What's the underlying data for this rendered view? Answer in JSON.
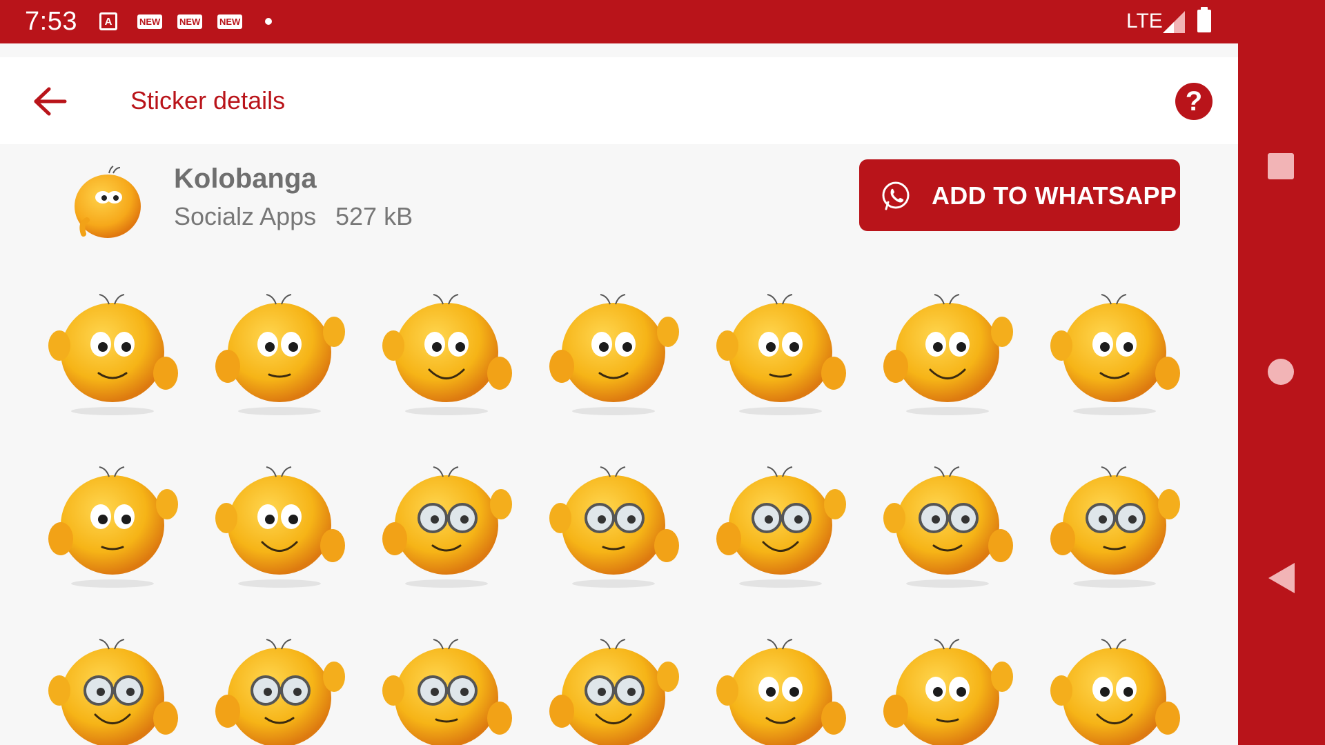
{
  "status_bar": {
    "time": "7:53",
    "notifications": [
      "app-icon",
      "new-badge",
      "new-badge",
      "new-badge",
      "dot"
    ],
    "notification_letter": "A",
    "new_label": "NEW",
    "network": "LTE"
  },
  "toolbar": {
    "title": "Sticker details",
    "help_label": "?"
  },
  "pack": {
    "name": "Kolobanga",
    "publisher": "Socialz Apps",
    "size": "527 kB",
    "add_button_label": "ADD TO WHATSAPP"
  },
  "stickers": [
    {
      "id": 1,
      "icon": "kolobanga-thumbs-up"
    },
    {
      "id": 2,
      "icon": "kolobanga-peace-wink"
    },
    {
      "id": 3,
      "icon": "kolobanga-pointing-down"
    },
    {
      "id": 4,
      "icon": "kolobanga-peeking-cap"
    },
    {
      "id": 5,
      "icon": "kolobanga-surprised"
    },
    {
      "id": 6,
      "icon": "kolobanga-thumbs-up-2"
    },
    {
      "id": 7,
      "icon": "kolobanga-fists-laughing"
    },
    {
      "id": 8,
      "icon": "kolobanga-waving"
    },
    {
      "id": 9,
      "icon": "kolobanga-sideeye"
    },
    {
      "id": 10,
      "icon": "kolobanga-glasses-adjust"
    },
    {
      "id": 11,
      "icon": "kolobanga-glasses-think"
    },
    {
      "id": 12,
      "icon": "kolobanga-glasses-notepad"
    },
    {
      "id": 13,
      "icon": "kolobanga-glasses-pointing"
    },
    {
      "id": 14,
      "icon": "kolobanga-glasses-hands-up"
    },
    {
      "id": 15,
      "icon": "kolobanga-glasses-fist"
    },
    {
      "id": 16,
      "icon": "kolobanga-glasses-idea"
    },
    {
      "id": 17,
      "icon": "kolobanga-glasses-big"
    },
    {
      "id": 18,
      "icon": "kolobanga-glasses-smile"
    },
    {
      "id": 19,
      "icon": "kolobanga-duo"
    },
    {
      "id": 20,
      "icon": "kolobanga-grin"
    },
    {
      "id": 21,
      "icon": "kolobanga-tongue"
    }
  ],
  "colors": {
    "accent": "#b9141a",
    "sticker_yellow": "#f6b417",
    "background": "#f7f7f7"
  }
}
